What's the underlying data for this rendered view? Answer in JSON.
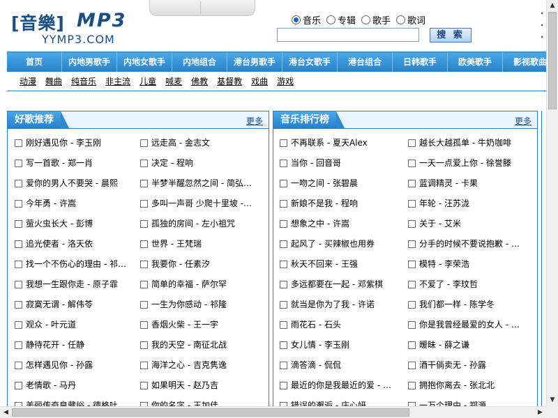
{
  "header": {
    "logo_cn": "[音樂]",
    "logo_mp3": "MP3",
    "logo_domain": "YYMP3.COM",
    "search_types": [
      {
        "label": "音乐",
        "checked": true
      },
      {
        "label": "专辑",
        "checked": false
      },
      {
        "label": "歌手",
        "checked": false
      },
      {
        "label": "歌词",
        "checked": false
      }
    ],
    "search_value": "",
    "search_button": "搜 索"
  },
  "nav": [
    "首页",
    "内地男歌手",
    "内地女歌手",
    "内地组合",
    "港台男歌手",
    "港台女歌手",
    "港台组合",
    "日韩歌手",
    "欧美歌手",
    "影视歌曲"
  ],
  "subnav": [
    "动漫",
    "舞曲",
    "纯音乐",
    "非主流",
    "儿童",
    "喊麦",
    "佛教",
    "基督教",
    "戏曲",
    "游戏"
  ],
  "left_panel": {
    "title": "好歌推荐",
    "more": "更多",
    "col1": [
      "刚好遇见你 - 李玉刚",
      "写一首歌 - 郑一肖",
      "爱你的男人不要哭 - 晨熙",
      "今年勇 - 许嵩",
      "萤火虫长大 - 彭博",
      "追光使者 - 洛天依",
      "找一个不伤心的理由 - 祁…",
      "我想一生跟你走 - 原子霏",
      "寂寞无谓 - 解伟苓",
      "观众 - 叶元道",
      "静待花开 - 任静",
      "怎样遇见你 - 孙露",
      "老情歌 - 马丹",
      "美丽传奇皇藏峪 - 德格吐…"
    ],
    "col2": [
      "远走高 - 金志文",
      "决定 - 程响",
      "半梦半醒忽然之间 - 简弘…",
      "多叫一声哥 少爬十里坡 -…",
      "孤独的房间 - 左小祖咒",
      "世界 - 王梵瑞",
      "我要你 - 任素汐",
      "简单的幸福 - 萨尔罕",
      "一生为你感动 - 祁隆",
      "香烟火柴 - 王一宇",
      "我的天空 - 南征北战",
      "海洋之心 - 吉克隽逸",
      "如果明天 - 赵乃吉",
      "你的名字 - 王加佳"
    ]
  },
  "right_panel": {
    "title": "音乐排行榜",
    "more": "更多",
    "col1": [
      "不再联系 - 夏天Alex",
      "当你 - 回音哥",
      "一吻之间 - 张碧晨",
      "新娘不是我 - 程响",
      "想象之中 - 许嵩",
      "起风了 - 买辣椒也用券",
      "秋天不回来 - 王强",
      "多远都要在一起 - 邓紫棋",
      "就当是你为了我 - 许诺",
      "雨花石 - 石头",
      "女儿情 - 李玉刚",
      "滴答滴 - 侃侃",
      "最近的你是我最近的爱 - …",
      "错误的邂逅 - 庄心妍"
    ],
    "col2": [
      "越长大越孤单 - 牛奶咖啡",
      "一天一点爱上你 - 徐誉滕",
      "蓝调精灵 - 卡果",
      "年轮 - 汪苏泷",
      "关于 - 艾米",
      "分手的时候不要说抱歉 - …",
      "模特 - 李荣浩",
      "不爱了 - 李玟哲",
      "我们都一样 - 陈学冬",
      "你是我曾经最爱的女人 - …",
      "暧昧 - 薛之谦",
      "酒干倘卖无 - 孙露",
      "拥抱你离去 - 张北北",
      "一万个理由 - 郑源"
    ]
  },
  "colors": {
    "accent": "#2a7fc4",
    "nav_top": "#4aa8e8",
    "nav_bottom": "#2680c8",
    "logo": "#1a4f86"
  }
}
